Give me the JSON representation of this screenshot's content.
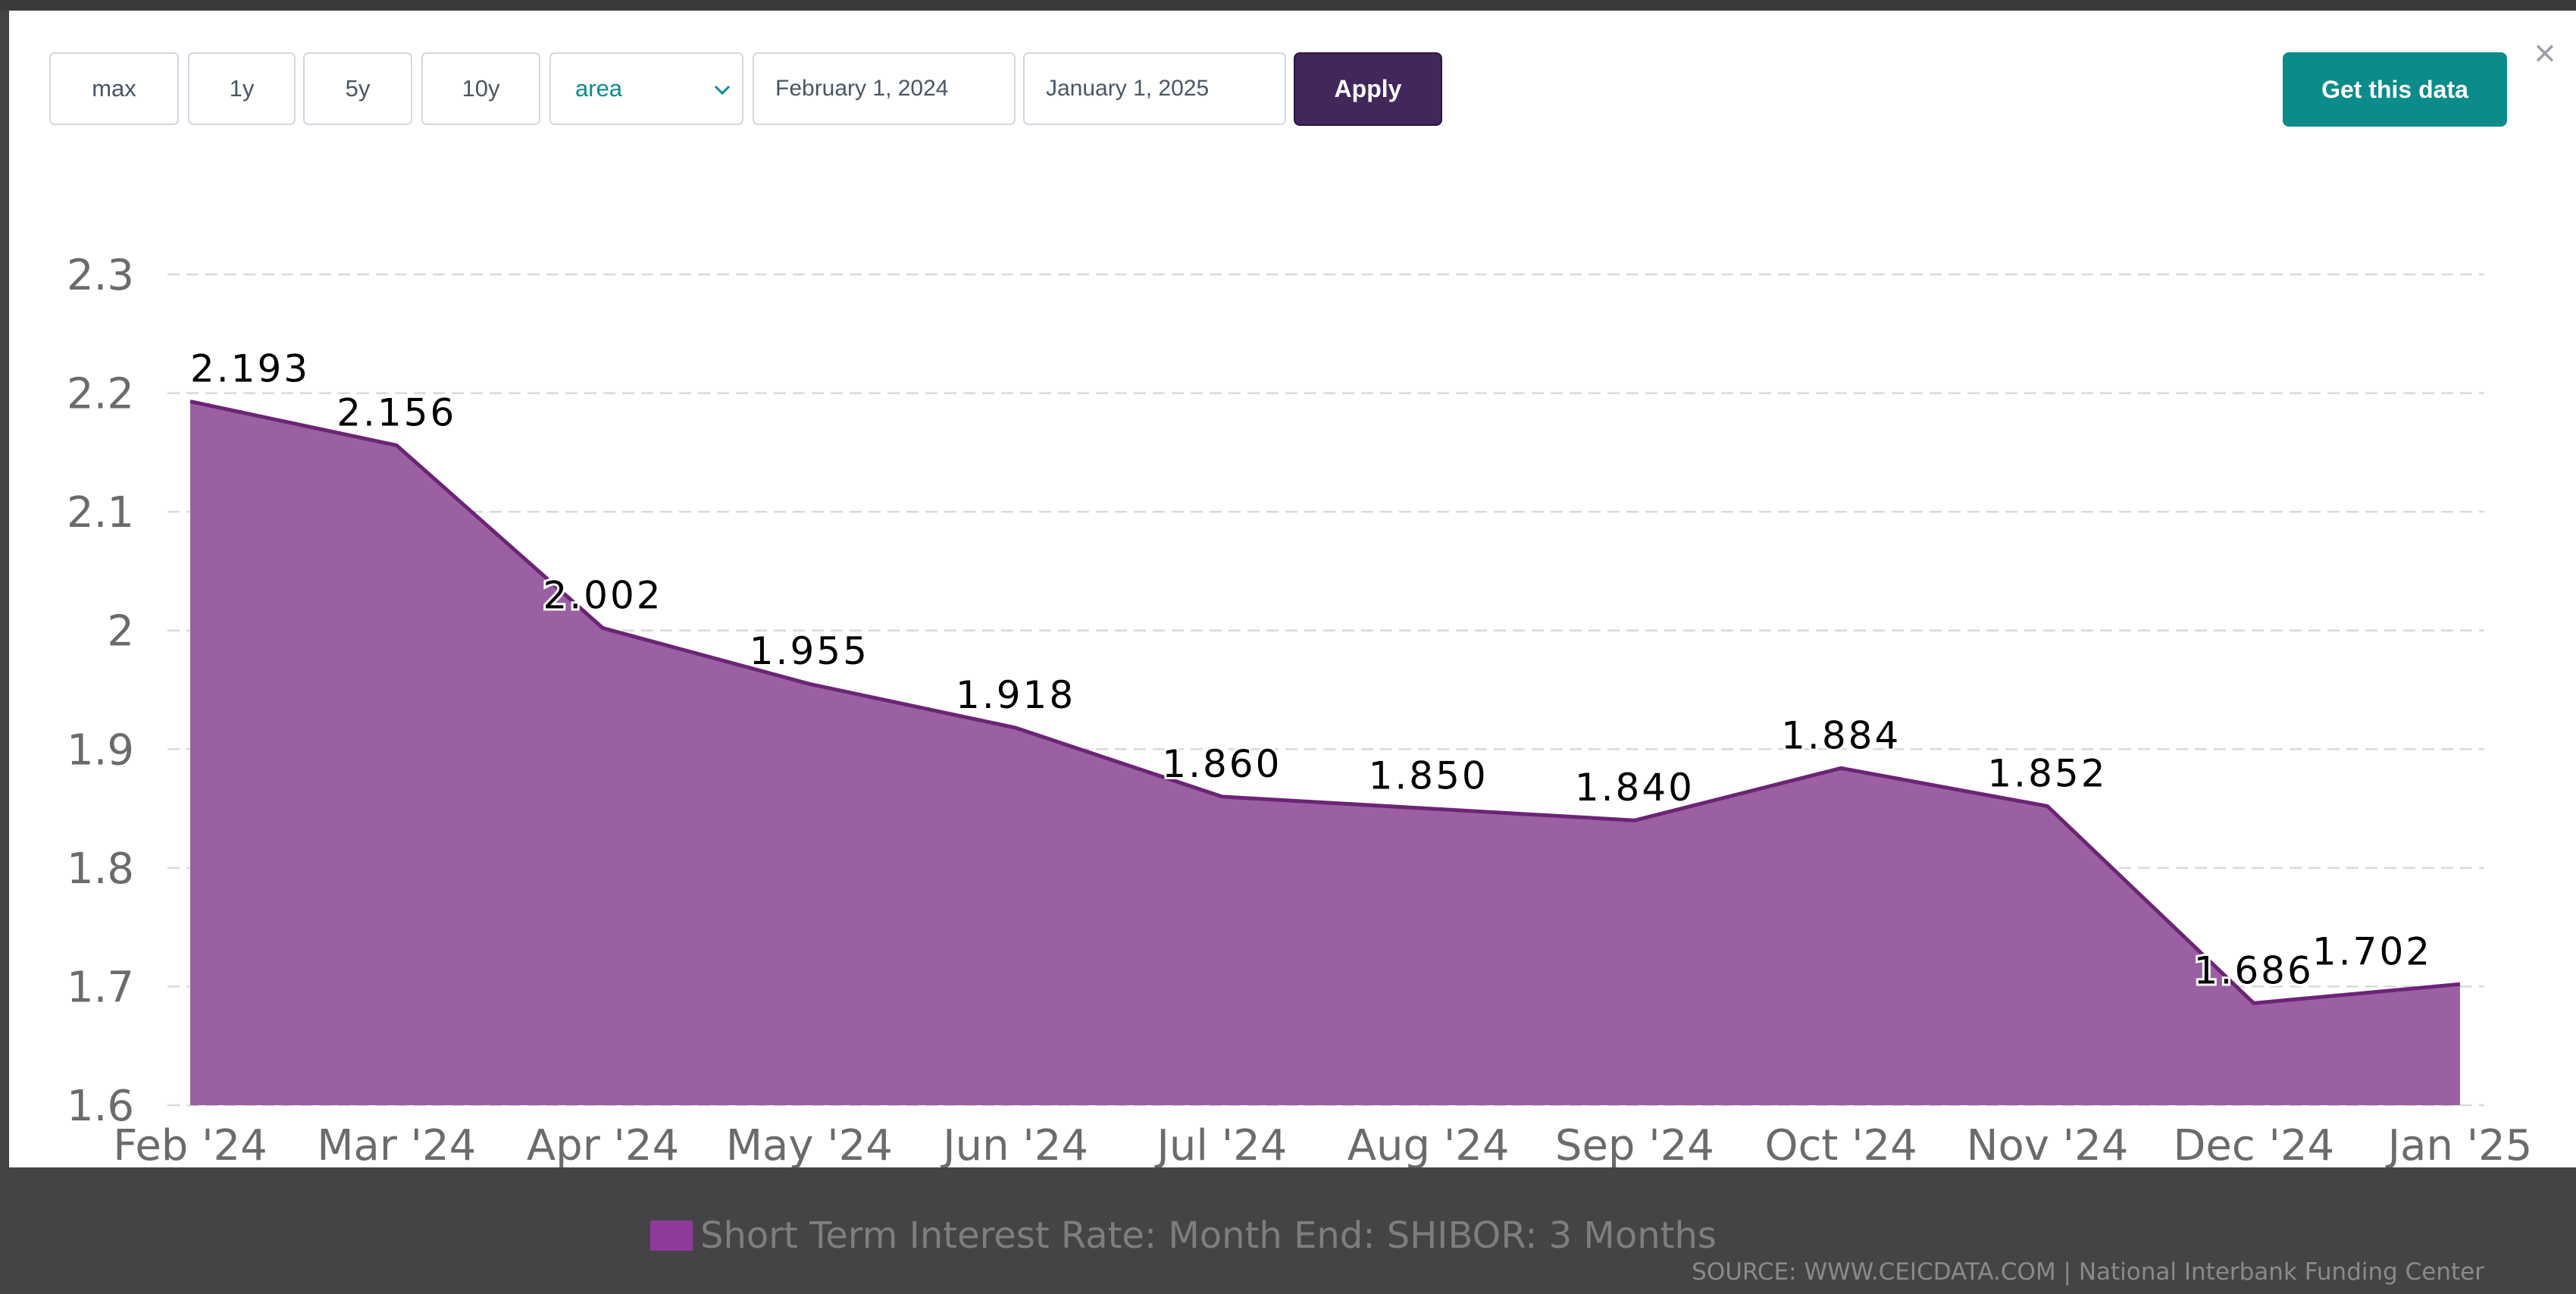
{
  "controls": {
    "range_buttons": [
      "max",
      "1y",
      "5y",
      "10y"
    ],
    "chart_type_selected": "area",
    "start_date": "February 1, 2024",
    "end_date": "January 1, 2025",
    "apply_label": "Apply",
    "get_data_label": "Get this data",
    "close_symbol": "×"
  },
  "colors": {
    "area_fill": "#9a60a2",
    "line": "#6c2476",
    "legend_swatch": "#8f3a98",
    "apply_bg": "#41275b",
    "get_data_bg": "#0b8b8a"
  },
  "chart_data": {
    "type": "area",
    "categories": [
      "Feb '24",
      "Mar '24",
      "Apr '24",
      "May '24",
      "Jun '24",
      "Jul '24",
      "Aug '24",
      "Sep '24",
      "Oct '24",
      "Nov '24",
      "Dec '24",
      "Jan '25"
    ],
    "series": [
      {
        "name": "Short Term Interest Rate: Month End: SHIBOR: 3 Months",
        "values": [
          2.193,
          2.156,
          2.002,
          1.955,
          1.918,
          1.86,
          1.85,
          1.84,
          1.884,
          1.852,
          1.686,
          1.702
        ],
        "labels": [
          "2.193",
          "2.156",
          "2.002",
          "1.955",
          "1.918",
          "1.860",
          "1.850",
          "1.840",
          "1.884",
          "1.852",
          "1.686",
          "1.702"
        ]
      }
    ],
    "ylim": [
      1.6,
      2.3
    ],
    "yticks": [
      1.6,
      1.7,
      1.8,
      1.9,
      2.0,
      2.1,
      2.2,
      2.3
    ],
    "ytick_labels": [
      "1.6",
      "1.7",
      "1.8",
      "1.9",
      "2",
      "2.1",
      "2.2",
      "2.3"
    ],
    "grid": true,
    "legend_position": "bottom"
  },
  "source_text": "SOURCE: WWW.CEICDATA.COM | National Interbank Funding Center"
}
